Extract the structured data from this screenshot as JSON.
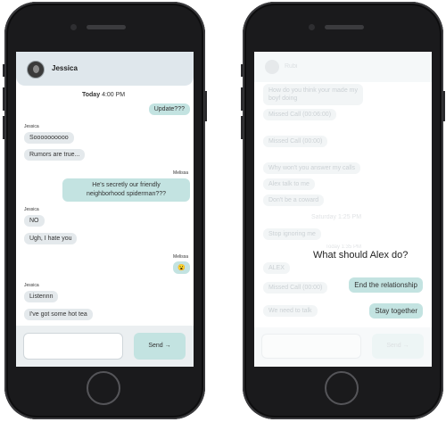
{
  "left_phone": {
    "header": {
      "contact_name": "Jessica"
    },
    "timestamp": {
      "day": "Today",
      "time": "4:00 PM"
    },
    "messages": [
      {
        "side": "out",
        "text": "Update???"
      },
      {
        "side": "in",
        "sender": "Jessica",
        "text": "Soooooooooo"
      },
      {
        "side": "in",
        "text": "Rumors are true..."
      },
      {
        "side": "out",
        "sender": "Melissa",
        "text": "He's secretly our friendly",
        "text2": "neighborhood spiderman???"
      },
      {
        "side": "in",
        "sender": "Jessica",
        "text": "NO"
      },
      {
        "side": "in",
        "text": "Ugh, I hate you"
      },
      {
        "side": "out",
        "sender": "Melissa",
        "text": "😮"
      },
      {
        "side": "in",
        "sender": "Jessica",
        "text": "Listennn"
      },
      {
        "side": "in",
        "text": "I've got some hot tea"
      }
    ],
    "composer": {
      "send_label": "Send →"
    }
  },
  "right_phone": {
    "prompt": "What should Alex do?",
    "choices": [
      "End the relationship",
      "Stay together"
    ],
    "faded": {
      "contact_name": "Rubi",
      "time": "Saturday 1:25 PM",
      "msg1": "How do you think your made my",
      "msg1b": "boyf doing",
      "missed1": "Missed Call (00:06:00)",
      "missed2": "Missed Call (00:00)",
      "msg2": "Why won't you answer my calls",
      "msg3": "Alex talk to me",
      "msg4": "Don't be a coward",
      "msg5": "Stop ignoring me",
      "time2": "Today 1:35 PM",
      "msg6": "ALEX",
      "missed3": "Missed Call (00:00)",
      "msg7": "We need to talk",
      "send_label": "Send →"
    }
  }
}
